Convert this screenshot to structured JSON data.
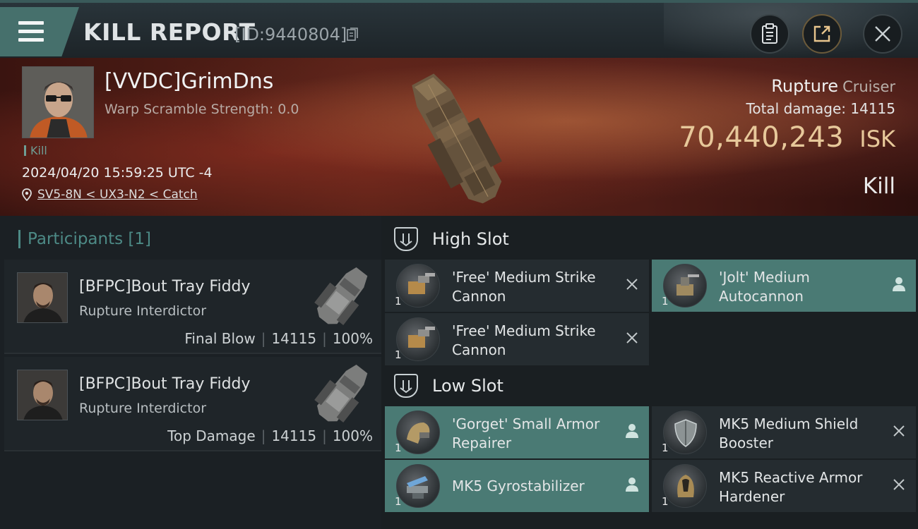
{
  "header": {
    "title": "KILL REPORT",
    "report_id": "[ID:9440804]"
  },
  "victim": {
    "name": "[VVDC]GrimDns",
    "warp_scramble": "Warp Scramble Strength: 0.0",
    "tag": "Kill",
    "timestamp": "2024/04/20 15:59:25 UTC -4",
    "location": "SV5-8N < UX3-N2 < Catch",
    "ship_name": "Rupture",
    "ship_class": "Cruiser",
    "total_damage_label": "Total damage:",
    "total_damage": "14115",
    "isk_value": "70,440,243",
    "isk_unit": "ISK",
    "outcome": "Kill"
  },
  "participants": {
    "header": "Participants [1]",
    "items": [
      {
        "name": "[BFPC]Bout Tray Fiddy",
        "ship": "Rupture Interdictor",
        "role": "Final Blow",
        "damage": "14115",
        "percent": "100%"
      },
      {
        "name": "[BFPC]Bout Tray Fiddy",
        "ship": "Rupture Interdictor",
        "role": "Top Damage",
        "damage": "14115",
        "percent": "100%"
      }
    ]
  },
  "slots": {
    "high": {
      "label": "High Slot",
      "modules": [
        {
          "name": "'Free' Medium Strike Cannon",
          "qty": "1",
          "state": "destroyed"
        },
        {
          "name": "'Jolt' Medium Autocannon",
          "qty": "1",
          "state": "dropped"
        },
        {
          "name": "'Free' Medium Strike Cannon",
          "qty": "1",
          "state": "destroyed"
        }
      ]
    },
    "low": {
      "label": "Low Slot",
      "modules": [
        {
          "name": "'Gorget' Small Armor Repairer",
          "qty": "1",
          "state": "dropped"
        },
        {
          "name": "MK5 Medium Shield Booster",
          "qty": "1",
          "state": "destroyed"
        },
        {
          "name": "MK5 Gyrostabilizer",
          "qty": "1",
          "state": "dropped"
        },
        {
          "name": "MK5 Reactive Armor Hardener",
          "qty": "1",
          "state": "destroyed"
        }
      ]
    }
  },
  "colors": {
    "accent_teal": "#4a7a74",
    "isk_gold": "#e7c89a",
    "participants_teal": "#4d8a86"
  }
}
